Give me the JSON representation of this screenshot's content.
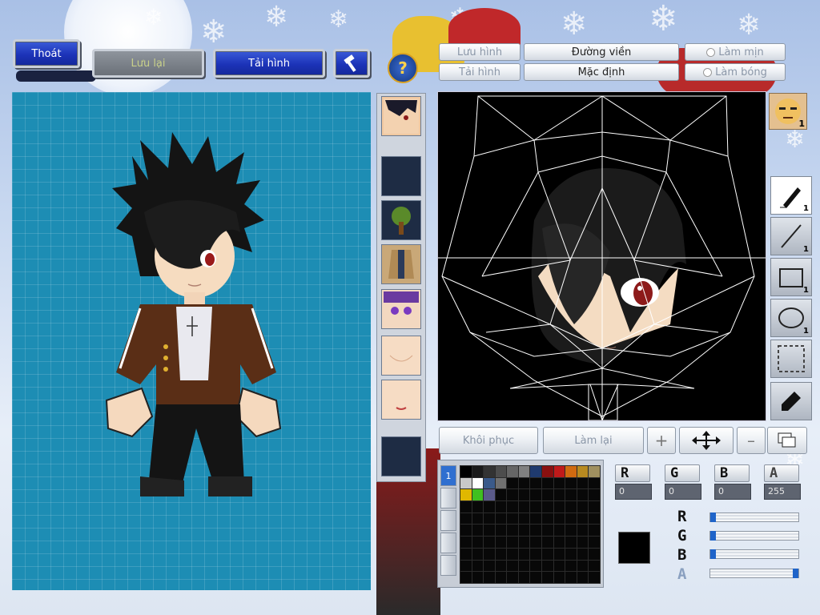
{
  "top_buttons": {
    "exit": "Thoát",
    "save": "Lưu lại",
    "load": "Tải hình"
  },
  "editor_buttons": {
    "save_image": "Lưu hình",
    "load_image": "Tải hình",
    "outline": "Đường viền",
    "default": "Mặc định",
    "smooth": "Làm mịn",
    "shade": "Làm bóng",
    "restore": "Khôi phục",
    "redo": "Làm lại"
  },
  "tools": [
    {
      "name": "pen",
      "count": "1"
    },
    {
      "name": "line",
      "count": "1"
    },
    {
      "name": "rectangle",
      "count": "1"
    },
    {
      "name": "ellipse",
      "count": "1"
    },
    {
      "name": "select",
      "count": ""
    },
    {
      "name": "eyedropper",
      "count": ""
    }
  ],
  "face_count": "1",
  "parts": [
    "face-portrait",
    "empty",
    "tree",
    "jacket-body",
    "purple-eyes",
    "skin-body",
    "skin-mouth",
    "empty"
  ],
  "color": {
    "labels": {
      "r": "R",
      "g": "G",
      "b": "B",
      "a": "A"
    },
    "values": {
      "r": "0",
      "g": "0",
      "b": "0",
      "a": "255"
    },
    "levels": {
      "r": 0,
      "g": 0,
      "b": 0,
      "a": 1.0
    },
    "current": "#000000"
  },
  "palette": [
    "#000000",
    "#1a1a1a",
    "#333333",
    "#4d4d4d",
    "#666666",
    "#808080",
    "#1f3a6e",
    "#8a1010",
    "#c01a1a",
    "#d06a10",
    "#b88a20",
    "#a09060",
    "#c8c8c8",
    "#ffffff",
    "#3a5a8a",
    "#707070"
  ],
  "palette_row2": [
    "#e0b800",
    "#40c020",
    "#5a5a8a"
  ],
  "palette_tab_selected": "1"
}
